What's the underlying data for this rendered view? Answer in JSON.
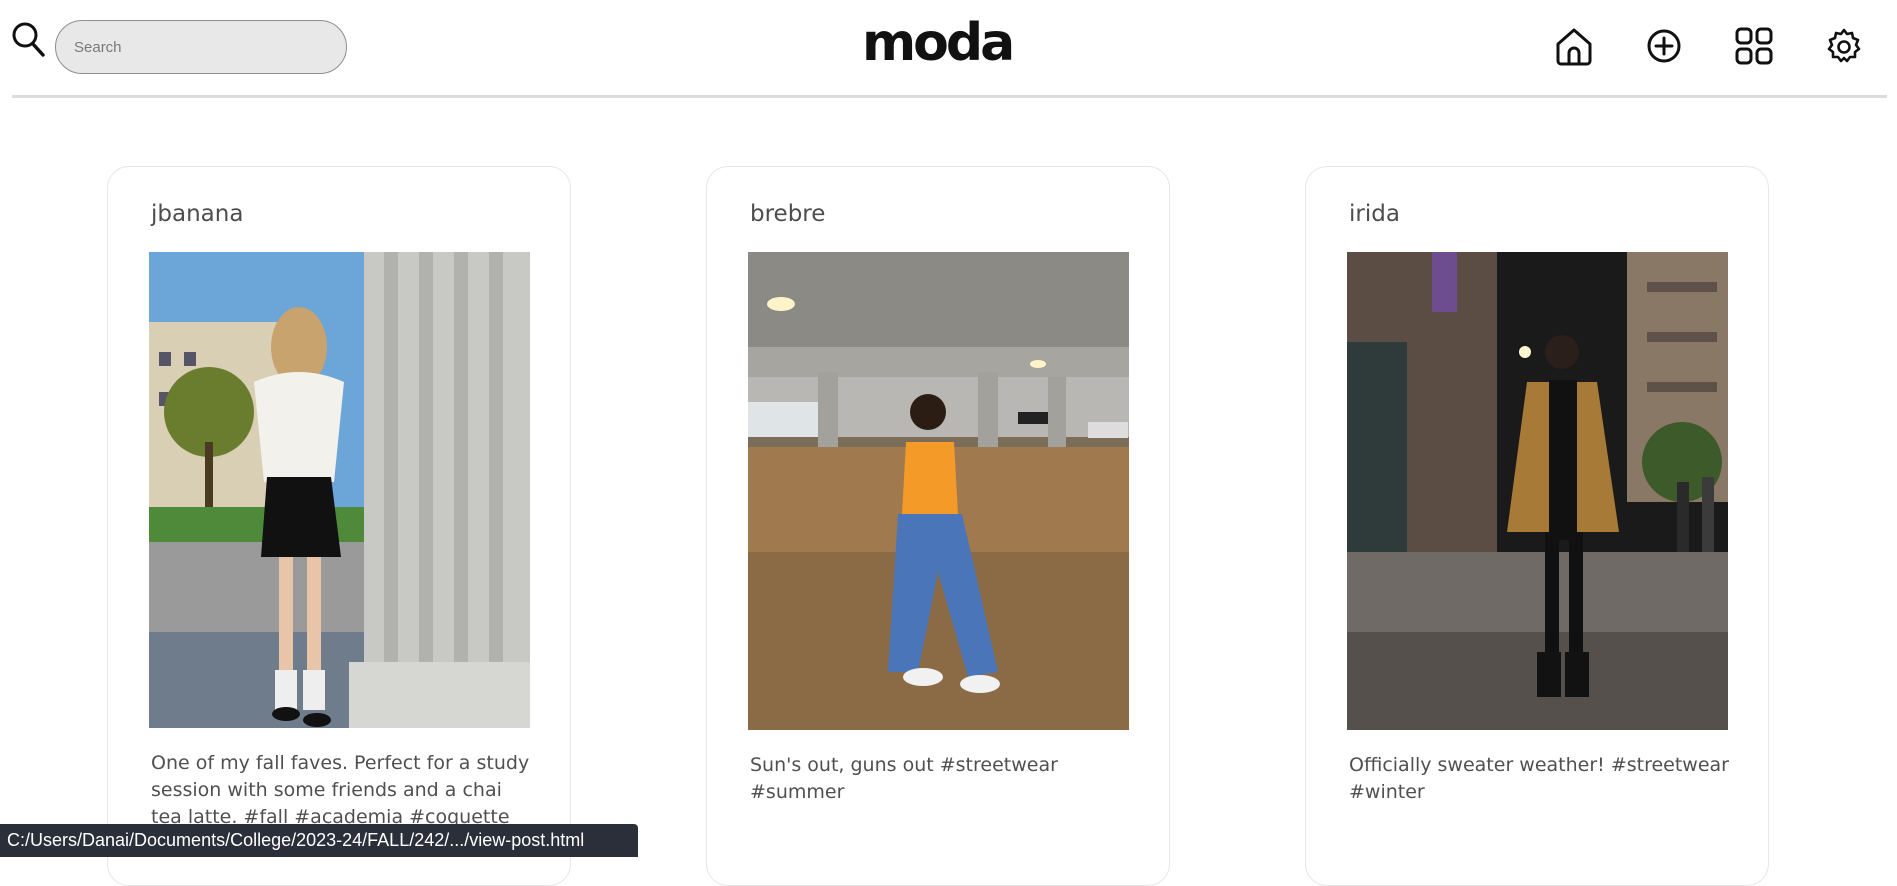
{
  "header": {
    "search_placeholder": "Search",
    "logo": "moda",
    "nav": [
      {
        "icon": "home-icon"
      },
      {
        "icon": "add-circle-icon"
      },
      {
        "icon": "grid-icon"
      },
      {
        "icon": "gear-icon"
      }
    ]
  },
  "posts": [
    {
      "username": "jbanana",
      "caption": "One of my fall faves. Perfect for a study session with some friends and a chai tea latte. #fall #academia #coquette"
    },
    {
      "username": "brebre",
      "caption": "Sun's out, guns out #streetwear #summer"
    },
    {
      "username": "irida",
      "caption": "Officially sweater weather! #streetwear #winter"
    }
  ],
  "status_bar": {
    "url": "C:/Users/Danai/Documents/College/2023-24/FALL/242/.../view-post.html"
  }
}
